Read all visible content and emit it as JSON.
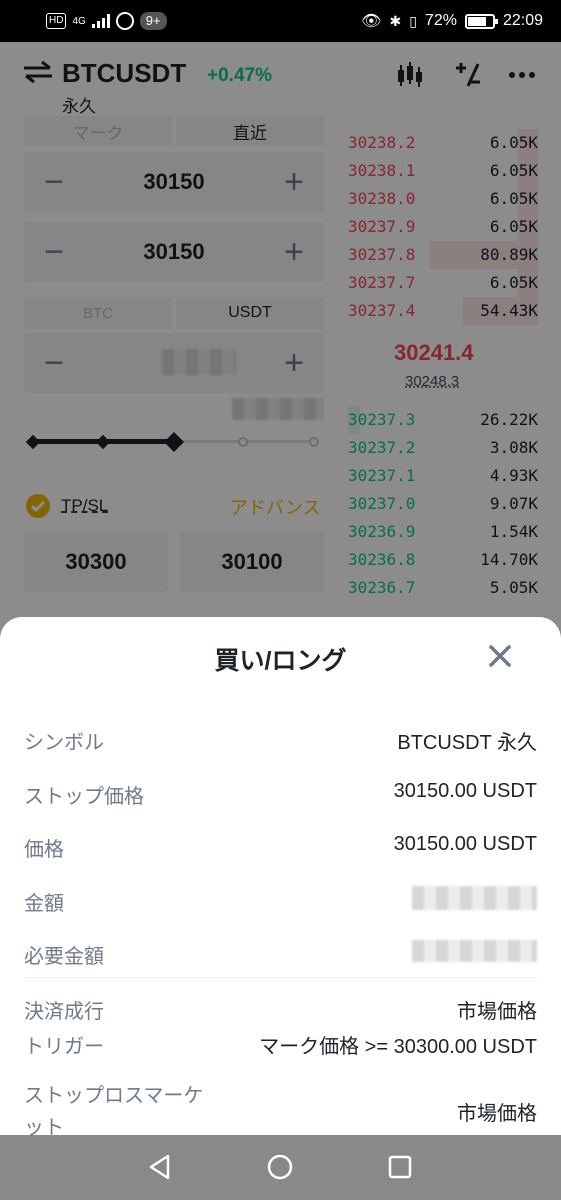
{
  "statusbar": {
    "hd": "HD",
    "net": "4G",
    "badge": "9+",
    "battery": "72%",
    "time": "22:09"
  },
  "header": {
    "pair": "BTCUSDT",
    "change": "+0.47%",
    "contract": "永久"
  },
  "order_form": {
    "tab_mark": "マーク",
    "tab_last": "直近",
    "stop_price": "30150",
    "price": "30150",
    "unit_btc": "BTC",
    "unit_usdt": "USDT",
    "slider_percent": 50,
    "tpsl_label": "TP/SL",
    "advanced_label": "アドバンス",
    "tp_value": "30300",
    "sl_value": "30100"
  },
  "orderbook": {
    "asks": [
      {
        "price": "30238.2",
        "qty": "6.05K"
      },
      {
        "price": "30238.1",
        "qty": "6.05K"
      },
      {
        "price": "30238.0",
        "qty": "6.05K"
      },
      {
        "price": "30237.9",
        "qty": "6.05K"
      },
      {
        "price": "30237.8",
        "qty": "80.89K"
      },
      {
        "price": "30237.7",
        "qty": "6.05K"
      },
      {
        "price": "30237.4",
        "qty": "54.43K"
      }
    ],
    "last_price": "30241.4",
    "mark_price": "30248.3",
    "bids": [
      {
        "price": "30237.3",
        "qty": "26.22K"
      },
      {
        "price": "30237.2",
        "qty": "3.08K"
      },
      {
        "price": "30237.1",
        "qty": "4.93K"
      },
      {
        "price": "30237.0",
        "qty": "9.07K"
      },
      {
        "price": "30236.9",
        "qty": "1.54K"
      },
      {
        "price": "30236.8",
        "qty": "14.70K"
      },
      {
        "price": "30236.7",
        "qty": "5.05K"
      }
    ]
  },
  "modal": {
    "title": "買い/ロング",
    "rows": [
      {
        "label": "シンボル",
        "value": "BTCUSDT 永久"
      },
      {
        "label": "ストップ価格",
        "value": "30150.00 USDT"
      },
      {
        "label": "価格",
        "value": "30150.00 USDT"
      },
      {
        "label": "金額",
        "value": ""
      },
      {
        "label": "必要金額",
        "value": ""
      },
      {
        "label": "決済成行",
        "value": "市場価格"
      },
      {
        "label": "トリガー",
        "value": "マーク価格 >= 30300.00 USDT"
      },
      {
        "label": "ストップロスマーケット",
        "value": "市場価格"
      }
    ]
  },
  "colors": {
    "buy": "#0ecb81",
    "sell": "#f6465d",
    "accent": "#f0b90b"
  }
}
